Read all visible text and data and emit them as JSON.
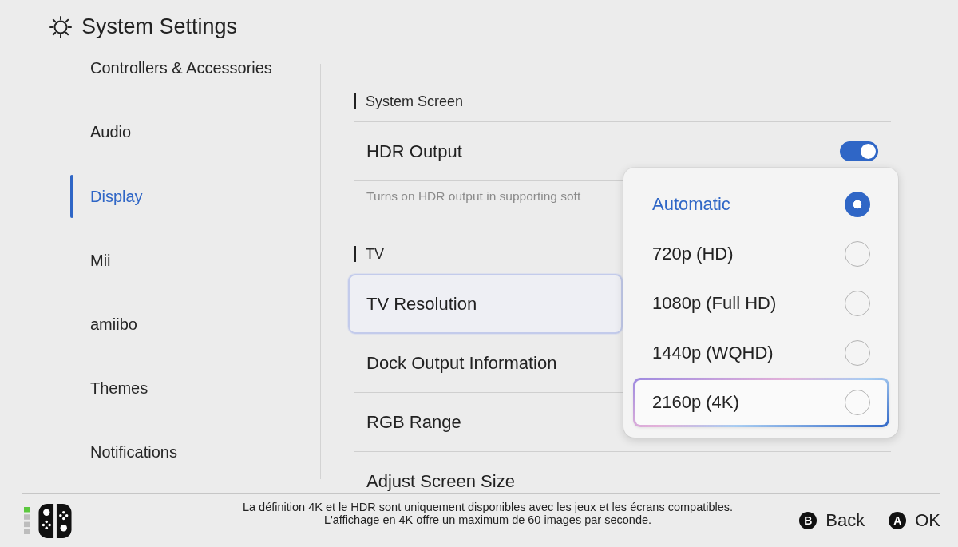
{
  "header": {
    "title": "System Settings"
  },
  "sidebar": {
    "groups": [
      {
        "items": [
          {
            "label": "Controllers & Accessories",
            "selected": false
          },
          {
            "label": "Audio",
            "selected": false
          }
        ]
      },
      {
        "items": [
          {
            "label": "Display",
            "selected": true
          },
          {
            "label": "Mii",
            "selected": false
          },
          {
            "label": "amiibo",
            "selected": false
          },
          {
            "label": "Themes",
            "selected": false
          },
          {
            "label": "Notifications",
            "selected": false
          }
        ]
      }
    ]
  },
  "content": {
    "sections": [
      {
        "heading": "System Screen",
        "rows": [
          {
            "kind": "toggle",
            "label": "HDR Output",
            "on": true,
            "description": "Turns on HDR output in supporting soft"
          }
        ]
      },
      {
        "heading": "TV",
        "rows": [
          {
            "kind": "link",
            "label": "TV Resolution",
            "focused": true
          },
          {
            "kind": "link",
            "label": "Dock Output Information",
            "focused": false
          },
          {
            "kind": "link",
            "label": "RGB Range",
            "focused": false
          },
          {
            "kind": "link",
            "label": "Adjust Screen Size",
            "focused": false
          }
        ]
      }
    ]
  },
  "resolution_menu": {
    "options": [
      {
        "label": "Automatic",
        "selected": true,
        "focused": false
      },
      {
        "label": "720p (HD)",
        "selected": false,
        "focused": false
      },
      {
        "label": "1080p (Full HD)",
        "selected": false,
        "focused": false
      },
      {
        "label": "1440p (WQHD)",
        "selected": false,
        "focused": false
      },
      {
        "label": "2160p (4K)",
        "selected": false,
        "focused": true
      }
    ]
  },
  "footer": {
    "notes": [
      "La définition 4K et le HDR sont uniquement disponibles avec les jeux et les écrans compatibles.",
      "L'affichage en 4K offre un maximum de 60 images par seconde."
    ],
    "buttons": [
      {
        "key": "B",
        "label": "Back"
      },
      {
        "key": "A",
        "label": "OK"
      }
    ]
  }
}
